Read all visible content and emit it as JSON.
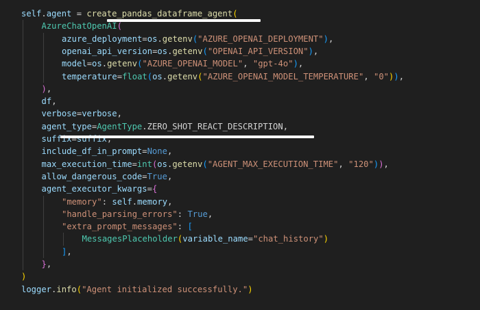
{
  "colors": {
    "background": "#1f1f1f",
    "variable": "#9cdcfe",
    "function": "#dcdcaa",
    "class": "#4ec9b0",
    "string": "#ce9178",
    "keyword_constant": "#569cd6",
    "punctuation": "#d4d4d4",
    "bracket_gold": "#ffd700",
    "bracket_pink": "#da70d6",
    "bracket_blue": "#179fff",
    "indent_guide": "#404040",
    "annotation_underline": "#ffffff"
  },
  "code": {
    "lines": [
      {
        "indent": 0,
        "tokens": [
          {
            "t": "self",
            "c": "#9cdcfe"
          },
          {
            "t": ".",
            "c": "#d4d4d4"
          },
          {
            "t": "agent",
            "c": "#9cdcfe"
          },
          {
            "t": " = ",
            "c": "#d4d4d4"
          },
          {
            "t": "create_pandas_dataframe_agent",
            "c": "#dcdcaa"
          },
          {
            "t": "(",
            "c": "#ffd700"
          }
        ]
      },
      {
        "indent": 1,
        "tokens": [
          {
            "t": "AzureChatOpenAI",
            "c": "#4ec9b0"
          },
          {
            "t": "(",
            "c": "#da70d6"
          }
        ]
      },
      {
        "indent": 2,
        "tokens": [
          {
            "t": "azure_deployment",
            "c": "#9cdcfe"
          },
          {
            "t": "=",
            "c": "#d4d4d4"
          },
          {
            "t": "os",
            "c": "#9cdcfe"
          },
          {
            "t": ".",
            "c": "#d4d4d4"
          },
          {
            "t": "getenv",
            "c": "#dcdcaa"
          },
          {
            "t": "(",
            "c": "#179fff"
          },
          {
            "t": "\"AZURE_OPENAI_DEPLOYMENT\"",
            "c": "#ce9178"
          },
          {
            "t": ")",
            "c": "#179fff"
          },
          {
            "t": ",",
            "c": "#d4d4d4"
          }
        ]
      },
      {
        "indent": 2,
        "tokens": [
          {
            "t": "openai_api_version",
            "c": "#9cdcfe"
          },
          {
            "t": "=",
            "c": "#d4d4d4"
          },
          {
            "t": "os",
            "c": "#9cdcfe"
          },
          {
            "t": ".",
            "c": "#d4d4d4"
          },
          {
            "t": "getenv",
            "c": "#dcdcaa"
          },
          {
            "t": "(",
            "c": "#179fff"
          },
          {
            "t": "\"OPENAI_API_VERSION\"",
            "c": "#ce9178"
          },
          {
            "t": ")",
            "c": "#179fff"
          },
          {
            "t": ",",
            "c": "#d4d4d4"
          }
        ]
      },
      {
        "indent": 2,
        "tokens": [
          {
            "t": "model",
            "c": "#9cdcfe"
          },
          {
            "t": "=",
            "c": "#d4d4d4"
          },
          {
            "t": "os",
            "c": "#9cdcfe"
          },
          {
            "t": ".",
            "c": "#d4d4d4"
          },
          {
            "t": "getenv",
            "c": "#dcdcaa"
          },
          {
            "t": "(",
            "c": "#179fff"
          },
          {
            "t": "\"AZURE_OPENAI_MODEL\"",
            "c": "#ce9178"
          },
          {
            "t": ", ",
            "c": "#d4d4d4"
          },
          {
            "t": "\"gpt-4o\"",
            "c": "#ce9178"
          },
          {
            "t": ")",
            "c": "#179fff"
          },
          {
            "t": ",",
            "c": "#d4d4d4"
          }
        ]
      },
      {
        "indent": 2,
        "tokens": [
          {
            "t": "temperature",
            "c": "#9cdcfe"
          },
          {
            "t": "=",
            "c": "#d4d4d4"
          },
          {
            "t": "float",
            "c": "#4ec9b0"
          },
          {
            "t": "(",
            "c": "#179fff"
          },
          {
            "t": "os",
            "c": "#9cdcfe"
          },
          {
            "t": ".",
            "c": "#d4d4d4"
          },
          {
            "t": "getenv",
            "c": "#dcdcaa"
          },
          {
            "t": "(",
            "c": "#ffd700"
          },
          {
            "t": "\"AZURE_OPENAI_MODEL_TEMPERATURE\"",
            "c": "#ce9178"
          },
          {
            "t": ", ",
            "c": "#d4d4d4"
          },
          {
            "t": "\"0\"",
            "c": "#ce9178"
          },
          {
            "t": ")",
            "c": "#ffd700"
          },
          {
            "t": ")",
            "c": "#179fff"
          },
          {
            "t": ",",
            "c": "#d4d4d4"
          }
        ]
      },
      {
        "indent": 1,
        "tokens": [
          {
            "t": ")",
            "c": "#da70d6"
          },
          {
            "t": ",",
            "c": "#d4d4d4"
          }
        ]
      },
      {
        "indent": 1,
        "tokens": [
          {
            "t": "df",
            "c": "#9cdcfe"
          },
          {
            "t": ",",
            "c": "#d4d4d4"
          }
        ]
      },
      {
        "indent": 1,
        "tokens": [
          {
            "t": "verbose",
            "c": "#9cdcfe"
          },
          {
            "t": "=",
            "c": "#d4d4d4"
          },
          {
            "t": "verbose",
            "c": "#9cdcfe"
          },
          {
            "t": ",",
            "c": "#d4d4d4"
          }
        ]
      },
      {
        "indent": 1,
        "tokens": [
          {
            "t": "agent_type",
            "c": "#9cdcfe"
          },
          {
            "t": "=",
            "c": "#d4d4d4"
          },
          {
            "t": "AgentType",
            "c": "#4ec9b0"
          },
          {
            "t": ".",
            "c": "#d4d4d4"
          },
          {
            "t": "ZERO_SHOT_REACT_DESCRIPTION",
            "c": "#d4d4d4"
          },
          {
            "t": ",",
            "c": "#d4d4d4"
          }
        ]
      },
      {
        "indent": 1,
        "tokens": [
          {
            "t": "suffix",
            "c": "#9cdcfe"
          },
          {
            "t": "=",
            "c": "#d4d4d4"
          },
          {
            "t": "suffix",
            "c": "#9cdcfe"
          },
          {
            "t": ",",
            "c": "#d4d4d4"
          }
        ]
      },
      {
        "indent": 1,
        "tokens": [
          {
            "t": "include_df_in_prompt",
            "c": "#9cdcfe"
          },
          {
            "t": "=",
            "c": "#d4d4d4"
          },
          {
            "t": "None",
            "c": "#569cd6"
          },
          {
            "t": ",",
            "c": "#d4d4d4"
          }
        ]
      },
      {
        "indent": 1,
        "tokens": [
          {
            "t": "max_execution_time",
            "c": "#9cdcfe"
          },
          {
            "t": "=",
            "c": "#d4d4d4"
          },
          {
            "t": "int",
            "c": "#4ec9b0"
          },
          {
            "t": "(",
            "c": "#da70d6"
          },
          {
            "t": "os",
            "c": "#9cdcfe"
          },
          {
            "t": ".",
            "c": "#d4d4d4"
          },
          {
            "t": "getenv",
            "c": "#dcdcaa"
          },
          {
            "t": "(",
            "c": "#179fff"
          },
          {
            "t": "\"AGENT_MAX_EXECUTION_TIME\"",
            "c": "#ce9178"
          },
          {
            "t": ", ",
            "c": "#d4d4d4"
          },
          {
            "t": "\"120\"",
            "c": "#ce9178"
          },
          {
            "t": ")",
            "c": "#179fff"
          },
          {
            "t": ")",
            "c": "#da70d6"
          },
          {
            "t": ",",
            "c": "#d4d4d4"
          }
        ]
      },
      {
        "indent": 1,
        "tokens": [
          {
            "t": "allow_dangerous_code",
            "c": "#9cdcfe"
          },
          {
            "t": "=",
            "c": "#d4d4d4"
          },
          {
            "t": "True",
            "c": "#569cd6"
          },
          {
            "t": ",",
            "c": "#d4d4d4"
          }
        ]
      },
      {
        "indent": 1,
        "tokens": [
          {
            "t": "agent_executor_kwargs",
            "c": "#9cdcfe"
          },
          {
            "t": "=",
            "c": "#d4d4d4"
          },
          {
            "t": "{",
            "c": "#da70d6"
          }
        ]
      },
      {
        "indent": 2,
        "tokens": [
          {
            "t": "\"memory\"",
            "c": "#ce9178"
          },
          {
            "t": ": ",
            "c": "#d4d4d4"
          },
          {
            "t": "self",
            "c": "#9cdcfe"
          },
          {
            "t": ".",
            "c": "#d4d4d4"
          },
          {
            "t": "memory",
            "c": "#9cdcfe"
          },
          {
            "t": ",",
            "c": "#d4d4d4"
          }
        ]
      },
      {
        "indent": 2,
        "tokens": [
          {
            "t": "\"handle_parsing_errors\"",
            "c": "#ce9178"
          },
          {
            "t": ": ",
            "c": "#d4d4d4"
          },
          {
            "t": "True",
            "c": "#569cd6"
          },
          {
            "t": ",",
            "c": "#d4d4d4"
          }
        ]
      },
      {
        "indent": 2,
        "tokens": [
          {
            "t": "\"extra_prompt_messages\"",
            "c": "#ce9178"
          },
          {
            "t": ": ",
            "c": "#d4d4d4"
          },
          {
            "t": "[",
            "c": "#179fff"
          }
        ]
      },
      {
        "indent": 3,
        "tokens": [
          {
            "t": "MessagesPlaceholder",
            "c": "#4ec9b0"
          },
          {
            "t": "(",
            "c": "#ffd700"
          },
          {
            "t": "variable_name",
            "c": "#9cdcfe"
          },
          {
            "t": "=",
            "c": "#d4d4d4"
          },
          {
            "t": "\"chat_history\"",
            "c": "#ce9178"
          },
          {
            "t": ")",
            "c": "#ffd700"
          }
        ]
      },
      {
        "indent": 2,
        "tokens": [
          {
            "t": "]",
            "c": "#179fff"
          },
          {
            "t": ",",
            "c": "#d4d4d4"
          }
        ]
      },
      {
        "indent": 1,
        "tokens": [
          {
            "t": "}",
            "c": "#da70d6"
          },
          {
            "t": ",",
            "c": "#d4d4d4"
          }
        ]
      },
      {
        "indent": 0,
        "tokens": [
          {
            "t": ")",
            "c": "#ffd700"
          }
        ]
      },
      {
        "indent": 0,
        "tokens": [
          {
            "t": "logger",
            "c": "#9cdcfe"
          },
          {
            "t": ".",
            "c": "#d4d4d4"
          },
          {
            "t": "info",
            "c": "#dcdcaa"
          },
          {
            "t": "(",
            "c": "#ffd700"
          },
          {
            "t": "\"Agent initialized successfully.\"",
            "c": "#ce9178"
          },
          {
            "t": ")",
            "c": "#ffd700"
          }
        ]
      }
    ]
  }
}
